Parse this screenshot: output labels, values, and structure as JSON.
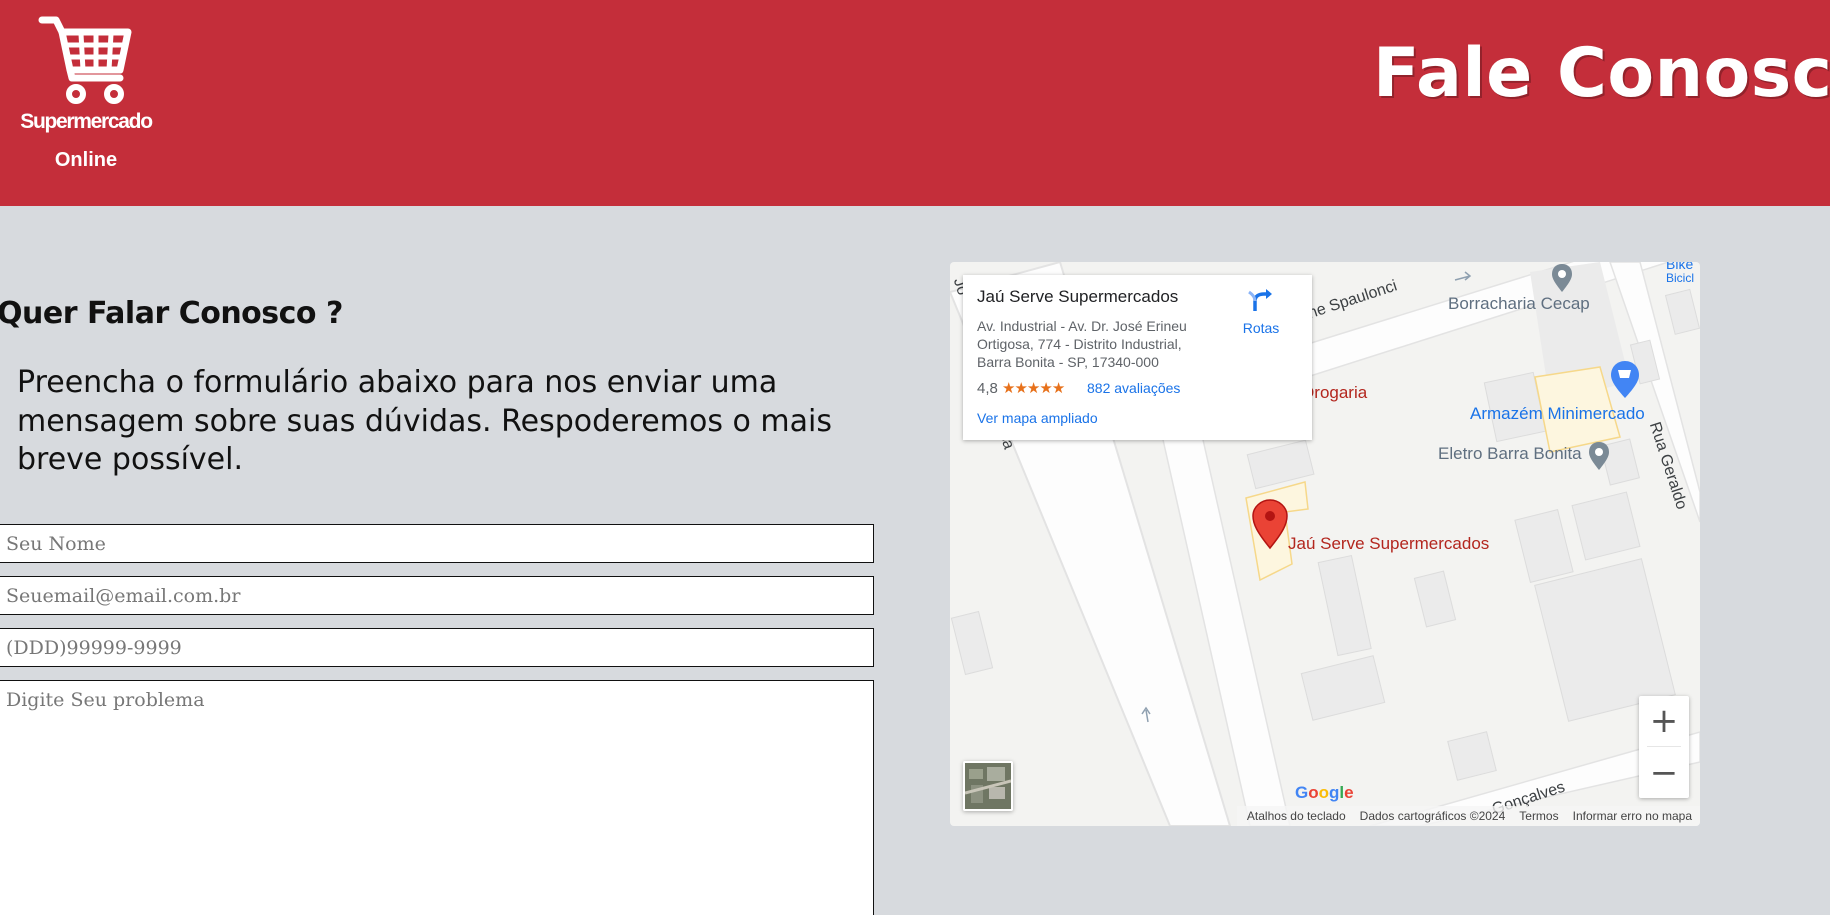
{
  "header": {
    "logo": {
      "name": "Supermercado",
      "sub": "Online",
      "icon": "shopping-cart-icon"
    },
    "title": "Fale Conosco",
    "background": "#c42e3a"
  },
  "contact": {
    "heading": "Quer Falar Conosco ?",
    "intro": "Preencha o formulário abaixo para nos enviar uma mensagem sobre suas dúvidas. Respoderemos o mais breve possível.",
    "fields": {
      "name_placeholder": "Seu Nome",
      "email_placeholder": "Seuemail@email.com.br",
      "phone_placeholder": "(DDD)99999-9999",
      "message_placeholder": "Digite Seu problema"
    }
  },
  "map": {
    "card": {
      "title": "Jaú Serve Supermercados",
      "address": "Av. Industrial - Av. Dr. José Erineu Ortigosa, 774 - Distrito Industrial, Barra Bonita - SP, 17340-000",
      "rating": "4,8",
      "stars": "★★★★★",
      "reviews": "882 avaliações",
      "directions": "Rotas",
      "larger_map": "Ver mapa ampliado"
    },
    "places": {
      "borracharia": "Borracharia Cecap",
      "drogaria": "Drogaria",
      "armazem": "Armazém Minimercado",
      "eletro": "Eletro Barra Bonita",
      "store": "Jaú Serve Supermercados",
      "bike": "Bike",
      "bike_sub": "Bicicl"
    },
    "roads": {
      "spaulonci": "ne Spaulonci",
      "geraldo": "Rua Geraldo",
      "goncalves": "Gonçalves",
      "jo": "Jo",
      "sa": "sa"
    },
    "controls": {
      "zoom_in": "+",
      "zoom_out": "−"
    },
    "google": "Google",
    "attribution": {
      "shortcuts": "Atalhos do teclado",
      "data": "Dados cartográficos ©2024",
      "terms": "Termos",
      "report": "Informar erro no mapa"
    }
  }
}
